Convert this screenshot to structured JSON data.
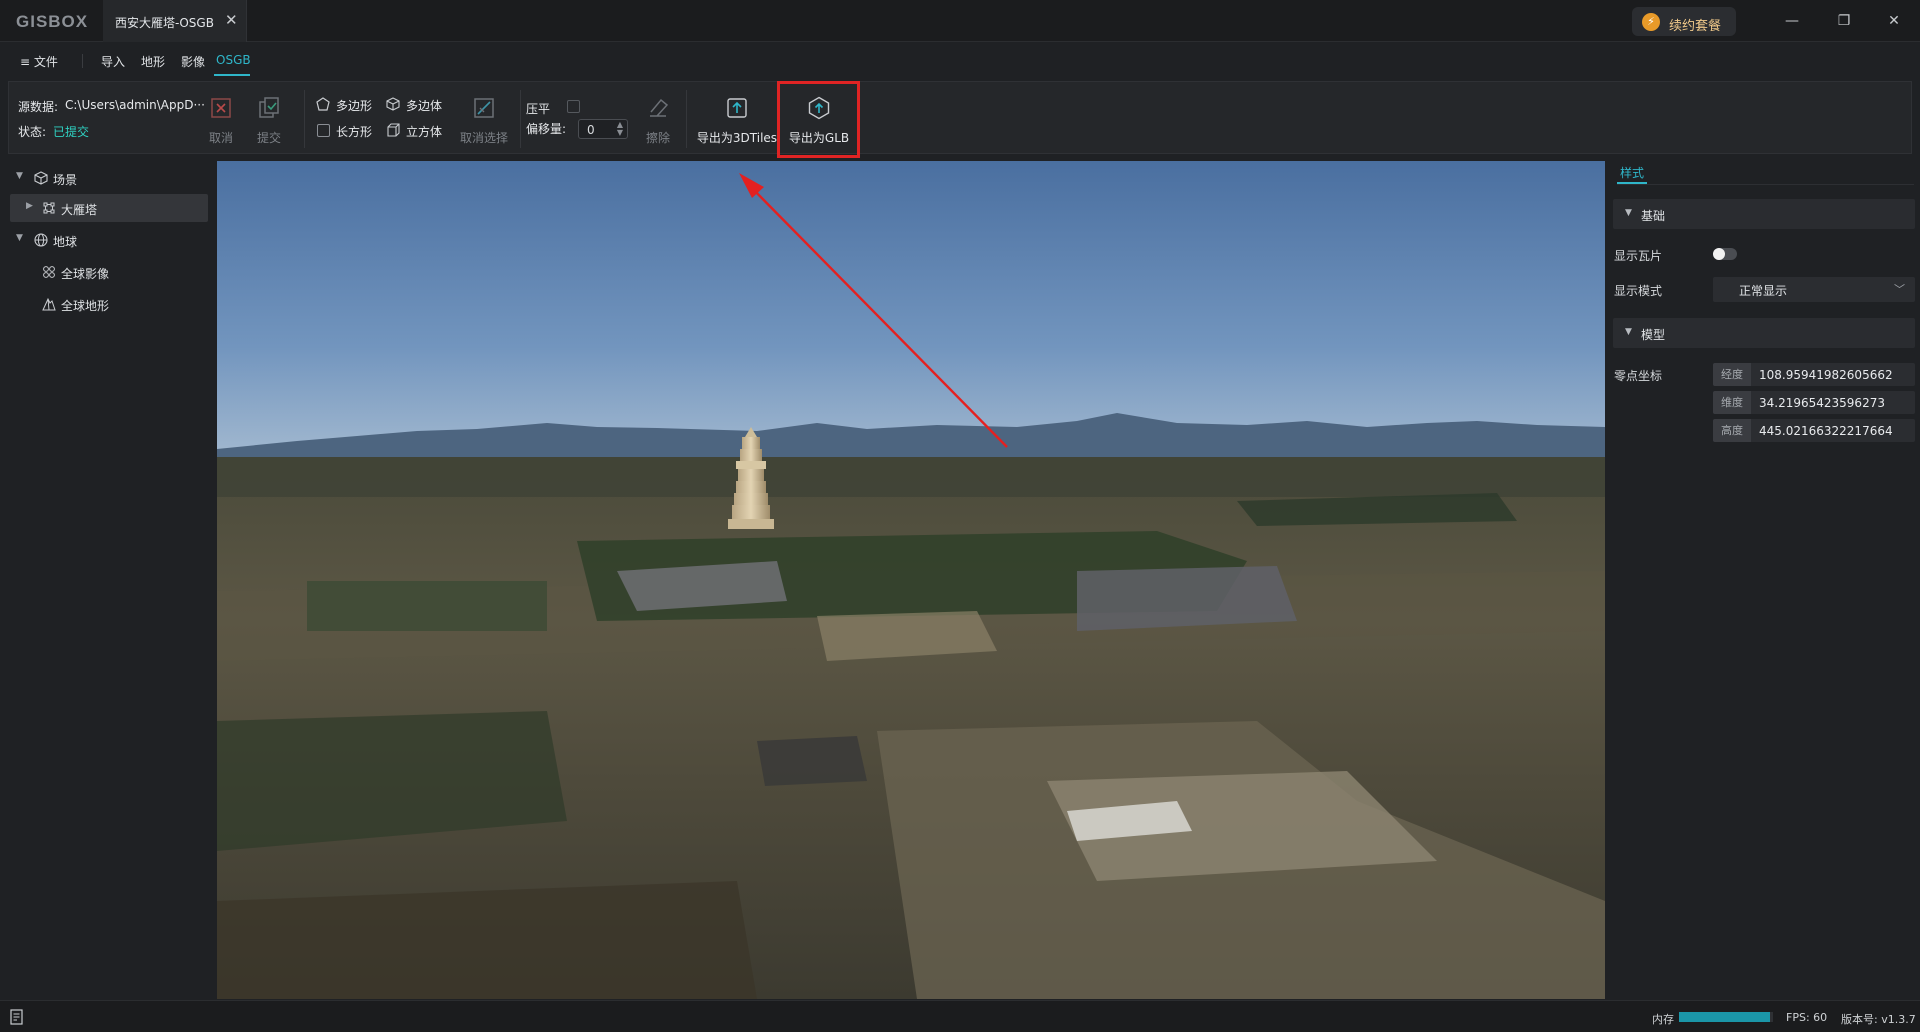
{
  "app": {
    "logo": "GISBOX"
  },
  "tab": {
    "title": "西安大雁塔-OSGB",
    "close": "✕"
  },
  "titlebar": {
    "renew_label": "续约套餐",
    "minimize": "—",
    "maximize": "❐",
    "close": "✕"
  },
  "menu": {
    "file": "≡ 文件",
    "items": [
      "导入",
      "地形",
      "影像",
      "OSGB"
    ],
    "active": "OSGB"
  },
  "toolbar": {
    "source_label": "源数据:",
    "source_value": "C:\\Users\\admin\\AppD···",
    "status_label": "状态:",
    "status_value": "已提交",
    "cancel": "取消",
    "submit": "提交",
    "polygon": "多边形",
    "rectangle": "长方形",
    "polyhedron": "多边体",
    "cube": "立方体",
    "cancel_select": "取消选择",
    "flatten": "压平",
    "offset_label": "偏移量:",
    "offset_value": "0",
    "erase": "擦除",
    "export_3dtiles": "导出为3DTiles",
    "export_glb": "导出为GLB"
  },
  "tree": {
    "scene": "场景",
    "layer": "大雁塔",
    "globe": "地球",
    "imagery": "全球影像",
    "terrain": "全球地形"
  },
  "panel": {
    "tab": "样式",
    "basic": "基础",
    "show_tiles": "显示瓦片",
    "show_tiles_on": false,
    "display_mode_label": "显示模式",
    "display_mode": "正常显示",
    "model": "模型",
    "origin_label": "零点坐标",
    "longitude_label": "经度",
    "longitude": "108.95941982605662",
    "latitude_label": "维度",
    "latitude": "34.21965423596273",
    "height_label": "高度",
    "height": "445.02166322217664"
  },
  "status": {
    "memory_label": "内存",
    "memory_fraction": 0.97,
    "fps": "FPS: 60",
    "version": "版本号: v1.3.7"
  },
  "colors": {
    "accent": "#2fb6c9",
    "highlight": "#e02424",
    "status_green": "#2fd1c1"
  }
}
